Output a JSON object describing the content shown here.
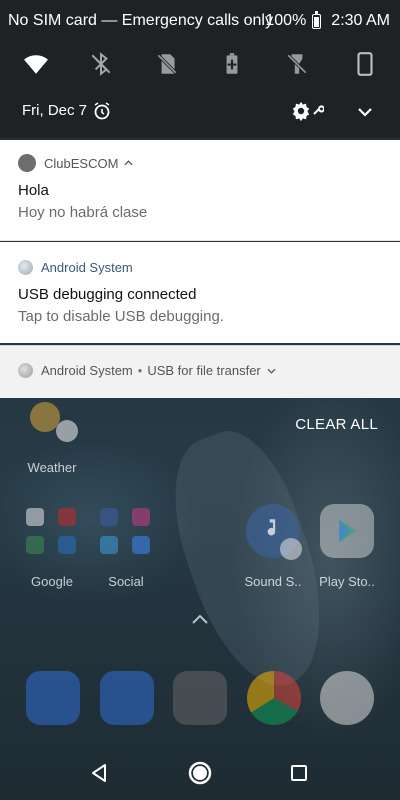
{
  "status_bar": {
    "carrier": "No SIM card — Emergency calls only",
    "battery": "100%",
    "time": "2:30 AM"
  },
  "quick_settings": {
    "tiles": [
      "wifi-icon",
      "bluetooth-off-icon",
      "data-off-icon",
      "battery-saver-icon",
      "flashlight-off-icon",
      "rotation-icon"
    ]
  },
  "header": {
    "date": "Fri, Dec 7"
  },
  "notifications": [
    {
      "app": "ClubESCOM",
      "title": "Hola",
      "body": "Hoy no habrá clase"
    },
    {
      "app": "Android System",
      "title": "USB debugging connected",
      "body": "Tap to disable USB debugging."
    },
    {
      "app": "Android System",
      "subtext": "USB for file transfer"
    }
  ],
  "actions": {
    "clear_all": "CLEAR ALL"
  },
  "home": {
    "labels": {
      "weather": "Weather",
      "google": "Google",
      "social": "Social",
      "sound": "Sound S..",
      "play": "Play Sto.."
    }
  },
  "colors": {
    "shade": "#1f2224",
    "card": "#ffffff",
    "collapsed_card": "#f2f2f2",
    "app_name_blue": "#3b5a7a"
  }
}
